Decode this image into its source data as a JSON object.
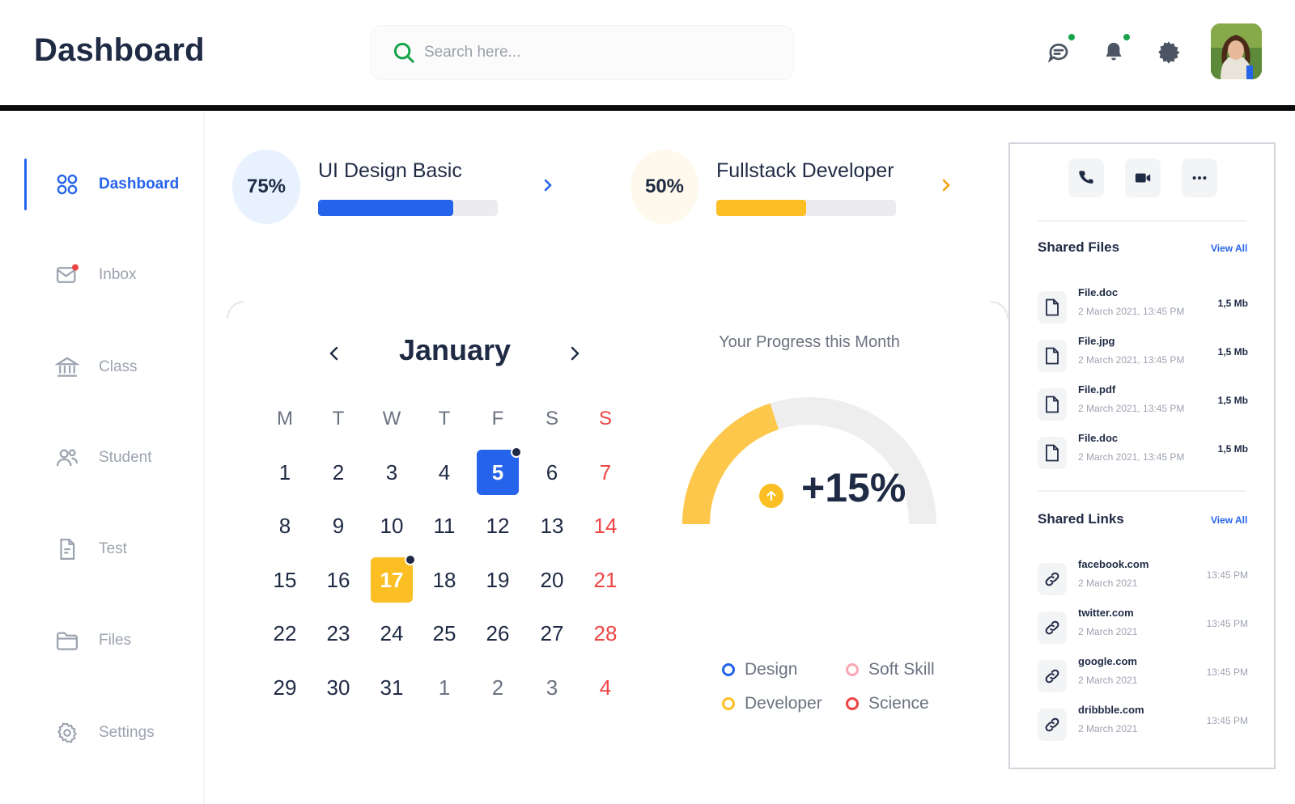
{
  "header": {
    "title": "Dashboard",
    "search_placeholder": "Search here...",
    "icons": [
      "chat-icon",
      "bell-icon",
      "gear-icon"
    ],
    "notification_dot_color": "#16a34a"
  },
  "sidebar": {
    "items": [
      {
        "label": "Dashboard",
        "icon": "grid-icon",
        "active": true
      },
      {
        "label": "Inbox",
        "icon": "mail-icon",
        "active": false
      },
      {
        "label": "Class",
        "icon": "building-icon",
        "active": false
      },
      {
        "label": "Student",
        "icon": "users-icon",
        "active": false
      },
      {
        "label": "Test",
        "icon": "document-icon",
        "active": false
      },
      {
        "label": "Files",
        "icon": "folder-icon",
        "active": false
      },
      {
        "label": "Settings",
        "icon": "gear-icon",
        "active": false
      }
    ]
  },
  "courses": [
    {
      "percent_label": "75%",
      "title": "UI Design Basic",
      "progress": 0.75,
      "color": "#2563eb",
      "bg": "#e8f1fe"
    },
    {
      "percent_label": "50%",
      "title": "Fullstack Developer",
      "progress": 0.5,
      "color": "#fbbf24",
      "bg": "#fef9ec"
    }
  ],
  "calendar": {
    "month": "January",
    "weekdays": [
      "M",
      "T",
      "W",
      "T",
      "F",
      "S",
      "S"
    ],
    "weeks": [
      [
        "1",
        "2",
        "3",
        "4",
        "5",
        "6",
        "7"
      ],
      [
        "8",
        "9",
        "10",
        "11",
        "12",
        "13",
        "14"
      ],
      [
        "15",
        "16",
        "17",
        "18",
        "19",
        "20",
        "21"
      ],
      [
        "22",
        "23",
        "24",
        "25",
        "26",
        "27",
        "28"
      ],
      [
        "29",
        "30",
        "31",
        "1",
        "2",
        "3",
        "4"
      ]
    ],
    "highlighted": [
      {
        "day": "5",
        "color": "#2563eb"
      },
      {
        "day": "17",
        "color": "#fbbf24"
      }
    ],
    "sunday_color": "#ef4444"
  },
  "progress": {
    "title": "Your Progress this Month",
    "value_label": "+15%",
    "gauge_fraction": 0.4,
    "gauge_color": "#fcc74a",
    "track_color": "#eeeeee",
    "legend": [
      {
        "label": "Design",
        "color": "#2563eb"
      },
      {
        "label": "Soft Skill",
        "color": "#f9a8b4"
      },
      {
        "label": "Developer",
        "color": "#fbbf24"
      },
      {
        "label": "Science",
        "color": "#ef4444"
      }
    ]
  },
  "right_panel": {
    "actions": [
      "phone-icon",
      "video-icon",
      "more-icon"
    ],
    "shared_files": {
      "title": "Shared Files",
      "view_all": "View All",
      "items": [
        {
          "name": "File.doc",
          "date": "2 March 2021, 13:45 PM",
          "size": "1,5 Mb"
        },
        {
          "name": "File.jpg",
          "date": "2 March 2021, 13:45 PM",
          "size": "1,5 Mb"
        },
        {
          "name": "File.pdf",
          "date": "2 March 2021, 13:45 PM",
          "size": "1,5 Mb"
        },
        {
          "name": "File.doc",
          "date": "2 March 2021, 13:45 PM",
          "size": "1,5 Mb"
        }
      ]
    },
    "shared_links": {
      "title": "Shared Links",
      "view_all": "View All",
      "items": [
        {
          "name": "facebook.com",
          "date": "2 March 2021",
          "time": "13:45 PM"
        },
        {
          "name": "twitter.com",
          "date": "2 March 2021",
          "time": "13:45 PM"
        },
        {
          "name": "google.com",
          "date": "2 March 2021",
          "time": "13:45 PM"
        },
        {
          "name": "dribbble.com",
          "date": "2 March 2021",
          "time": "13:45 PM"
        }
      ]
    }
  }
}
